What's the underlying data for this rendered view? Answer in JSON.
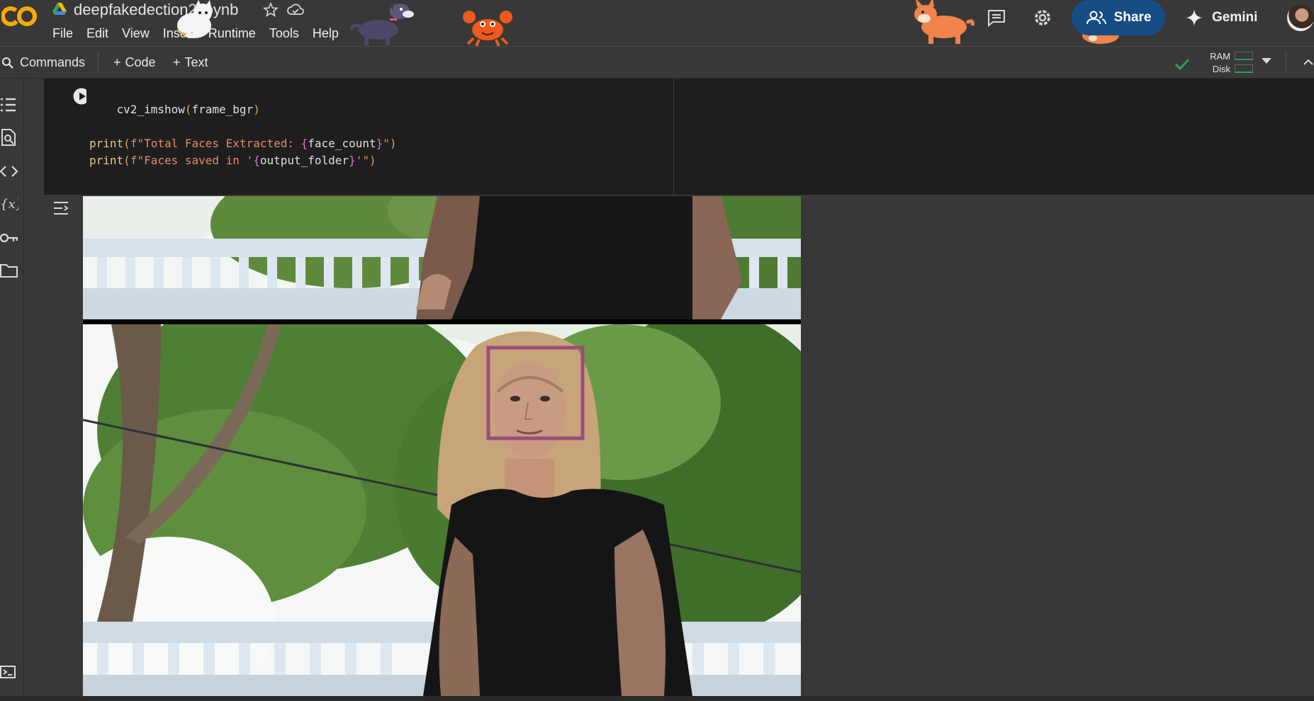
{
  "header": {
    "logo_text": "CO",
    "notebook_title": "deepfakedection2.ipynb",
    "menu": [
      "File",
      "Edit",
      "View",
      "Insert",
      "Runtime",
      "Tools",
      "Help"
    ],
    "share_label": "Share",
    "gemini_label": "Gemini"
  },
  "toolbar": {
    "commands_label": "Commands",
    "add_code_label": "Code",
    "add_text_label": "Text",
    "ram_label": "RAM",
    "disk_label": "Disk"
  },
  "colors": {
    "accent_blue": "#174d85",
    "background": "#383838",
    "code_background": "#1e1e1e",
    "connected_green": "#2ea05b",
    "face_box": "#9a4d7a"
  },
  "icons": [
    "drive-icon",
    "star-icon",
    "cloud-icon",
    "comment-icon",
    "settings-icon",
    "people-icon",
    "sparkle-icon",
    "search-icon",
    "check-icon",
    "toc-icon",
    "find-icon",
    "code-snippets-icon",
    "variables-icon",
    "key-icon",
    "folder-icon",
    "terminal-icon",
    "play-icon",
    "output-toggle-icon"
  ],
  "cell": {
    "code_lines": [
      [
        [
          "c-plain",
          "    cv2_imshow"
        ],
        [
          "c-br",
          "("
        ],
        [
          "c-plain",
          "frame_bgr"
        ],
        [
          "c-br",
          ")"
        ]
      ],
      [
        [
          "c-plain",
          ""
        ]
      ],
      [
        [
          "c-fn",
          "print"
        ],
        [
          "c-br",
          "("
        ],
        [
          "c-str",
          "f\"Total Faces Extracted: "
        ],
        [
          "c-pink",
          "{"
        ],
        [
          "c-plain",
          "face_count"
        ],
        [
          "c-pink",
          "}"
        ],
        [
          "c-str",
          "\""
        ],
        [
          "c-br",
          ")"
        ]
      ],
      [
        [
          "c-fn",
          "print"
        ],
        [
          "c-br",
          "("
        ],
        [
          "c-str",
          "f\"Faces saved in '"
        ],
        [
          "c-pink",
          "{"
        ],
        [
          "c-plain",
          "output_folder"
        ],
        [
          "c-pink",
          "}"
        ],
        [
          "c-str",
          "'\""
        ],
        [
          "c-br",
          ")"
        ]
      ]
    ]
  }
}
